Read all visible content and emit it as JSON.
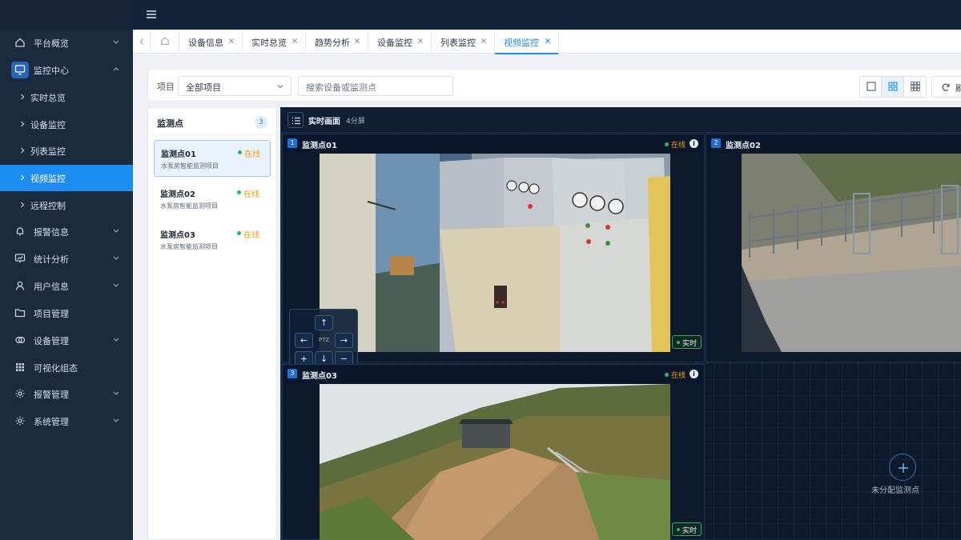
{
  "sidebar": {
    "items": [
      {
        "label": "平台概览",
        "icon": "home-icon",
        "caret": "down"
      },
      {
        "label": "监控中心",
        "icon": "monitor-icon",
        "caret": "up",
        "active_parent": true
      },
      {
        "label": "报警信息",
        "icon": "bell-icon",
        "caret": "down"
      },
      {
        "label": "统计分析",
        "icon": "chart-icon",
        "caret": "down"
      },
      {
        "label": "用户信息",
        "icon": "user-icon",
        "caret": "down"
      },
      {
        "label": "项目管理",
        "icon": "folder-icon",
        "caret": ""
      },
      {
        "label": "设备管理",
        "icon": "devices-icon",
        "caret": "down"
      },
      {
        "label": "可视化组态",
        "icon": "grid-icon",
        "caret": ""
      },
      {
        "label": "报警管理",
        "icon": "gear-icon",
        "caret": "down"
      },
      {
        "label": "系统管理",
        "icon": "gear-icon",
        "caret": "down"
      }
    ],
    "sub_items": [
      {
        "label": "实时总览"
      },
      {
        "label": "设备监控"
      },
      {
        "label": "列表监控"
      },
      {
        "label": "视频监控",
        "active": true
      },
      {
        "label": "远程控制"
      }
    ]
  },
  "tabs": {
    "items": [
      {
        "label": "设备信息"
      },
      {
        "label": "实时总览"
      },
      {
        "label": "趋势分析"
      },
      {
        "label": "设备监控"
      },
      {
        "label": "列表监控"
      },
      {
        "label": "视频监控",
        "active": true
      }
    ]
  },
  "filter": {
    "project_label": "项目",
    "project_value": "全部项目",
    "search_placeholder": "搜索设备或监测点",
    "refresh_label": "刷"
  },
  "points": {
    "title": "监测点",
    "count": "3",
    "items": [
      {
        "name": "监测点01",
        "status": "在线",
        "project": "水泵房智能监测项目",
        "selected": true
      },
      {
        "name": "监测点02",
        "status": "在线",
        "project": "水泵房智能监测项目"
      },
      {
        "name": "监测点03",
        "status": "在线",
        "project": "水泵房智能监测项目"
      }
    ]
  },
  "video": {
    "title": "实时画面",
    "layout_label": "4分屏",
    "cells": [
      {
        "num": "1",
        "name": "监测点01",
        "status": "在线",
        "live": "实时"
      },
      {
        "num": "2",
        "name": "监测点02"
      },
      {
        "num": "3",
        "name": "监测点03",
        "status": "在线",
        "live": "实时"
      }
    ],
    "ptz": {
      "center": "PTZ",
      "up": "↑",
      "down": "↓",
      "left": "←",
      "right": "→",
      "zoom_in": "+",
      "zoom_out": "−"
    },
    "empty_label": "未分配监测点"
  },
  "colors": {
    "accent": "#1e8df2",
    "online_dot": "#28b765",
    "status_text": "#f29b11",
    "sidebar_bg": "#1b2a3e"
  }
}
